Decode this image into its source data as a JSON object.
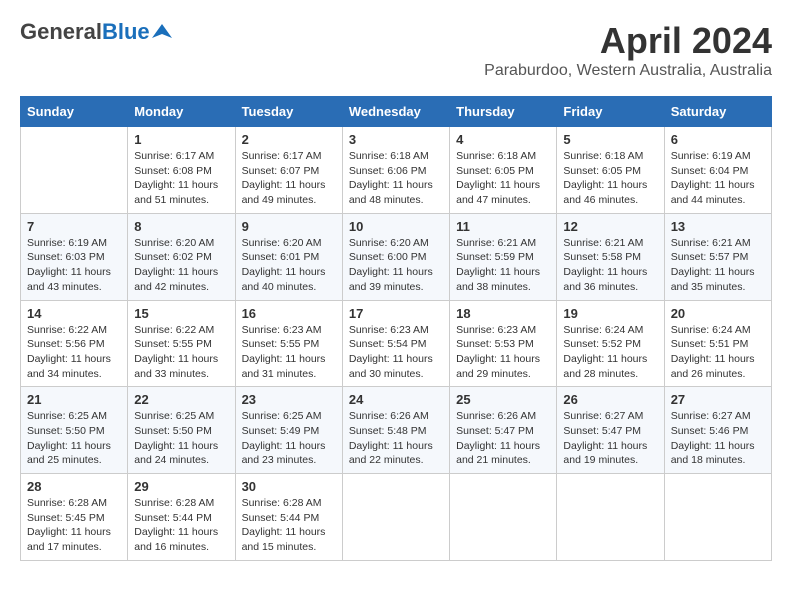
{
  "header": {
    "logo_general": "General",
    "logo_blue": "Blue",
    "month_title": "April 2024",
    "subtitle": "Paraburdoo, Western Australia, Australia"
  },
  "calendar": {
    "days_of_week": [
      "Sunday",
      "Monday",
      "Tuesday",
      "Wednesday",
      "Thursday",
      "Friday",
      "Saturday"
    ],
    "weeks": [
      [
        {
          "day": "",
          "info": ""
        },
        {
          "day": "1",
          "info": "Sunrise: 6:17 AM\nSunset: 6:08 PM\nDaylight: 11 hours\nand 51 minutes."
        },
        {
          "day": "2",
          "info": "Sunrise: 6:17 AM\nSunset: 6:07 PM\nDaylight: 11 hours\nand 49 minutes."
        },
        {
          "day": "3",
          "info": "Sunrise: 6:18 AM\nSunset: 6:06 PM\nDaylight: 11 hours\nand 48 minutes."
        },
        {
          "day": "4",
          "info": "Sunrise: 6:18 AM\nSunset: 6:05 PM\nDaylight: 11 hours\nand 47 minutes."
        },
        {
          "day": "5",
          "info": "Sunrise: 6:18 AM\nSunset: 6:05 PM\nDaylight: 11 hours\nand 46 minutes."
        },
        {
          "day": "6",
          "info": "Sunrise: 6:19 AM\nSunset: 6:04 PM\nDaylight: 11 hours\nand 44 minutes."
        }
      ],
      [
        {
          "day": "7",
          "info": "Sunrise: 6:19 AM\nSunset: 6:03 PM\nDaylight: 11 hours\nand 43 minutes."
        },
        {
          "day": "8",
          "info": "Sunrise: 6:20 AM\nSunset: 6:02 PM\nDaylight: 11 hours\nand 42 minutes."
        },
        {
          "day": "9",
          "info": "Sunrise: 6:20 AM\nSunset: 6:01 PM\nDaylight: 11 hours\nand 40 minutes."
        },
        {
          "day": "10",
          "info": "Sunrise: 6:20 AM\nSunset: 6:00 PM\nDaylight: 11 hours\nand 39 minutes."
        },
        {
          "day": "11",
          "info": "Sunrise: 6:21 AM\nSunset: 5:59 PM\nDaylight: 11 hours\nand 38 minutes."
        },
        {
          "day": "12",
          "info": "Sunrise: 6:21 AM\nSunset: 5:58 PM\nDaylight: 11 hours\nand 36 minutes."
        },
        {
          "day": "13",
          "info": "Sunrise: 6:21 AM\nSunset: 5:57 PM\nDaylight: 11 hours\nand 35 minutes."
        }
      ],
      [
        {
          "day": "14",
          "info": "Sunrise: 6:22 AM\nSunset: 5:56 PM\nDaylight: 11 hours\nand 34 minutes."
        },
        {
          "day": "15",
          "info": "Sunrise: 6:22 AM\nSunset: 5:55 PM\nDaylight: 11 hours\nand 33 minutes."
        },
        {
          "day": "16",
          "info": "Sunrise: 6:23 AM\nSunset: 5:55 PM\nDaylight: 11 hours\nand 31 minutes."
        },
        {
          "day": "17",
          "info": "Sunrise: 6:23 AM\nSunset: 5:54 PM\nDaylight: 11 hours\nand 30 minutes."
        },
        {
          "day": "18",
          "info": "Sunrise: 6:23 AM\nSunset: 5:53 PM\nDaylight: 11 hours\nand 29 minutes."
        },
        {
          "day": "19",
          "info": "Sunrise: 6:24 AM\nSunset: 5:52 PM\nDaylight: 11 hours\nand 28 minutes."
        },
        {
          "day": "20",
          "info": "Sunrise: 6:24 AM\nSunset: 5:51 PM\nDaylight: 11 hours\nand 26 minutes."
        }
      ],
      [
        {
          "day": "21",
          "info": "Sunrise: 6:25 AM\nSunset: 5:50 PM\nDaylight: 11 hours\nand 25 minutes."
        },
        {
          "day": "22",
          "info": "Sunrise: 6:25 AM\nSunset: 5:50 PM\nDaylight: 11 hours\nand 24 minutes."
        },
        {
          "day": "23",
          "info": "Sunrise: 6:25 AM\nSunset: 5:49 PM\nDaylight: 11 hours\nand 23 minutes."
        },
        {
          "day": "24",
          "info": "Sunrise: 6:26 AM\nSunset: 5:48 PM\nDaylight: 11 hours\nand 22 minutes."
        },
        {
          "day": "25",
          "info": "Sunrise: 6:26 AM\nSunset: 5:47 PM\nDaylight: 11 hours\nand 21 minutes."
        },
        {
          "day": "26",
          "info": "Sunrise: 6:27 AM\nSunset: 5:47 PM\nDaylight: 11 hours\nand 19 minutes."
        },
        {
          "day": "27",
          "info": "Sunrise: 6:27 AM\nSunset: 5:46 PM\nDaylight: 11 hours\nand 18 minutes."
        }
      ],
      [
        {
          "day": "28",
          "info": "Sunrise: 6:28 AM\nSunset: 5:45 PM\nDaylight: 11 hours\nand 17 minutes."
        },
        {
          "day": "29",
          "info": "Sunrise: 6:28 AM\nSunset: 5:44 PM\nDaylight: 11 hours\nand 16 minutes."
        },
        {
          "day": "30",
          "info": "Sunrise: 6:28 AM\nSunset: 5:44 PM\nDaylight: 11 hours\nand 15 minutes."
        },
        {
          "day": "",
          "info": ""
        },
        {
          "day": "",
          "info": ""
        },
        {
          "day": "",
          "info": ""
        },
        {
          "day": "",
          "info": ""
        }
      ]
    ]
  }
}
